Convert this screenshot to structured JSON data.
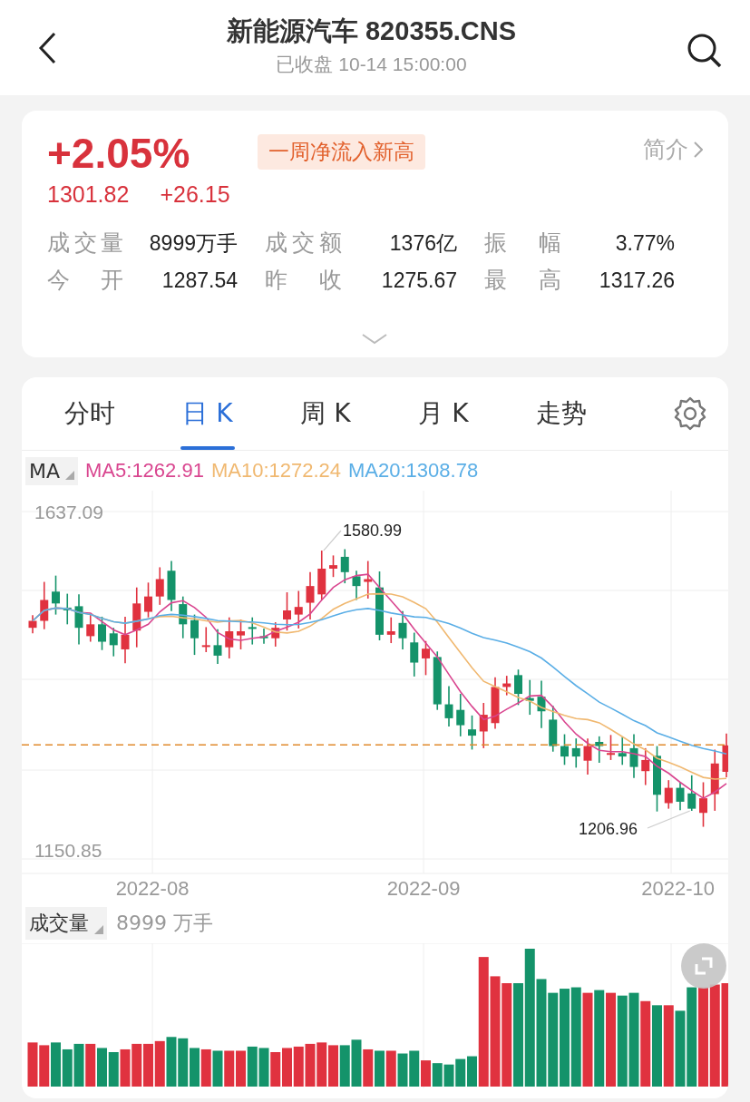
{
  "header": {
    "title": "新能源汽车 820355.CNS",
    "subtitle": "已收盘 10-14 15:00:00"
  },
  "quote": {
    "change_percent": "+2.05%",
    "badge": "一周净流入新高",
    "intro_link": "简介",
    "price": "1301.82",
    "change": "+26.15",
    "stats": [
      {
        "label": "成交量",
        "value": "8999万手"
      },
      {
        "label": "成交额",
        "value": "1376亿"
      },
      {
        "label": "振幅",
        "value": "3.77%"
      },
      {
        "label": "今开",
        "value": "1287.54"
      },
      {
        "label": "昨收",
        "value": "1275.67"
      },
      {
        "label": "最高",
        "value": "1317.26"
      }
    ]
  },
  "tabs": [
    {
      "label": "分时",
      "selected": false
    },
    {
      "label": "日 K",
      "selected": true
    },
    {
      "label": "周 K",
      "selected": false
    },
    {
      "label": "月 K",
      "selected": false
    },
    {
      "label": "走势",
      "selected": false
    }
  ],
  "ma_legend": {
    "selector": "MA",
    "items": [
      {
        "label": "MA5:1262.91",
        "color": "#d9458f"
      },
      {
        "label": "MA10:1272.24",
        "color": "#f0b870"
      },
      {
        "label": "MA20:1308.78",
        "color": "#5aaee6"
      }
    ]
  },
  "kline": {
    "y_max": "1637.09",
    "y_min": "1150.85",
    "high_label": "1580.99",
    "low_label": "1206.96",
    "x_labels": [
      "2022-08",
      "2022-09",
      "2022-10"
    ]
  },
  "volume": {
    "selector": "成交量",
    "value": "8999 万手"
  }
}
